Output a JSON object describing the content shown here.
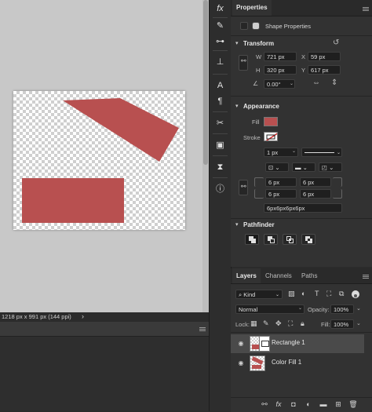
{
  "colors": {
    "shape_fill": "#b85050",
    "panel_bg": "#323232",
    "canvas_bg": "#c8c8c8"
  },
  "status": {
    "doc_info": "1218 px x 991 px (144 ppi)",
    "arrow": "›"
  },
  "toolbar": {
    "tools": [
      {
        "icon": "fx-icon",
        "glyph": "fx"
      },
      {
        "icon": "brush-icon",
        "glyph": "✎"
      },
      {
        "icon": "adjust-sliders-icon",
        "glyph": "⊶"
      },
      {
        "icon": "stamp-icon",
        "glyph": "⊥"
      },
      {
        "icon": "type-icon",
        "glyph": "A"
      },
      {
        "icon": "paragraph-icon",
        "glyph": "¶"
      },
      {
        "icon": "tools-icon",
        "glyph": "✂"
      },
      {
        "icon": "library-icon",
        "glyph": "▣"
      },
      {
        "icon": "history-icon",
        "glyph": "⧗"
      },
      {
        "icon": "info-icon",
        "glyph": "ⓘ"
      }
    ]
  },
  "properties": {
    "tab_label": "Properties",
    "kind_label": "Shape Properties",
    "transform": {
      "title": "Transform",
      "w_label": "W",
      "w_value": "721 px",
      "x_label": "X",
      "x_value": "59 px",
      "h_label": "H",
      "h_value": "320 px",
      "y_label": "Y",
      "y_value": "617 px",
      "angle_value": "0.00°"
    },
    "appearance": {
      "title": "Appearance",
      "fill_label": "Fill",
      "stroke_label": "Stroke",
      "stroke_width": "1 px",
      "radius_tl": "6 px",
      "radius_tr": "6 px",
      "radius_bl": "6 px",
      "radius_br": "6 px",
      "radius_all": "6px6px6px6px"
    },
    "pathfinder": {
      "title": "Pathfinder"
    }
  },
  "layers": {
    "tabs": [
      "Layers",
      "Channels",
      "Paths"
    ],
    "filter_kind": "Kind",
    "blend_mode": "Normal",
    "opacity_label": "Opacity:",
    "opacity_value": "100%",
    "lock_label": "Lock:",
    "fill_label": "Fill:",
    "fill_value": "100%",
    "items": [
      {
        "name": "Rectangle 1",
        "selected": true
      },
      {
        "name": "Color Fill 1",
        "selected": false
      }
    ],
    "bottom_fx": "fx"
  }
}
